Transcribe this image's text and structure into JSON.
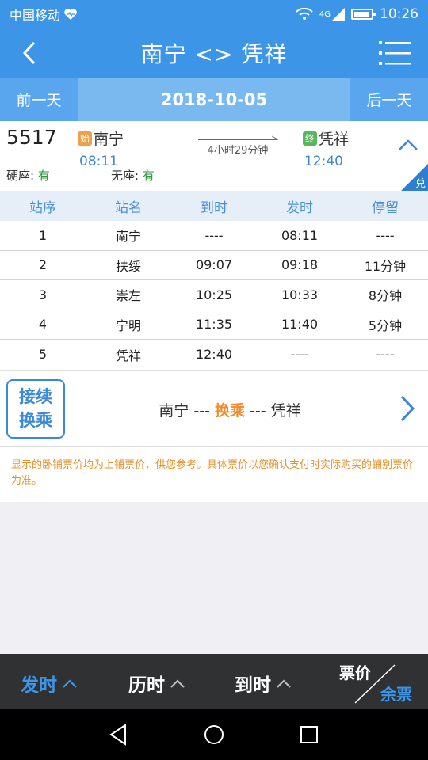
{
  "status_bar": {
    "carrier": "中国移动",
    "network": "4G",
    "time": "10:26"
  },
  "header": {
    "title": "南宁 <> 凭祥"
  },
  "date_bar": {
    "prev": "前一天",
    "date": "2018-10-05",
    "next": "后一天"
  },
  "train": {
    "number": "5517",
    "start_tag": "始",
    "from": "南宁",
    "depart_time": "08:11",
    "duration": "4小时29分钟",
    "end_tag": "终",
    "to": "凭祥",
    "arrive_time": "12:40",
    "seats": [
      {
        "label": "硬座:",
        "status": "有"
      },
      {
        "label": "无座:",
        "status": "有"
      }
    ],
    "corner_badge": "兑"
  },
  "stops_table": {
    "headers": [
      "站序",
      "站名",
      "到时",
      "发时",
      "停留"
    ],
    "rows": [
      [
        "1",
        "南宁",
        "----",
        "08:11",
        "----"
      ],
      [
        "2",
        "扶绥",
        "09:07",
        "09:18",
        "11分钟"
      ],
      [
        "3",
        "崇左",
        "10:25",
        "10:33",
        "8分钟"
      ],
      [
        "4",
        "宁明",
        "11:35",
        "11:40",
        "5分钟"
      ],
      [
        "5",
        "凭祥",
        "12:40",
        "----",
        "----"
      ]
    ]
  },
  "transfer": {
    "badge_line1": "接续",
    "badge_line2": "换乘",
    "from": "南宁",
    "sep1": " --- ",
    "middle": "换乘",
    "sep2": " --- ",
    "to": "凭祥"
  },
  "notice": "显示的卧铺票价均为上铺票价，供您参考。具体票价以您确认支付时实际购买的铺别票价为准。",
  "bottom_tabs": {
    "depart": "发时",
    "duration": "历时",
    "arrive": "到时",
    "price": "票价",
    "remaining": "余票"
  },
  "colors": {
    "primary": "#3d95e8",
    "accent": "#f08a2a",
    "available": "#2e9a3a"
  }
}
